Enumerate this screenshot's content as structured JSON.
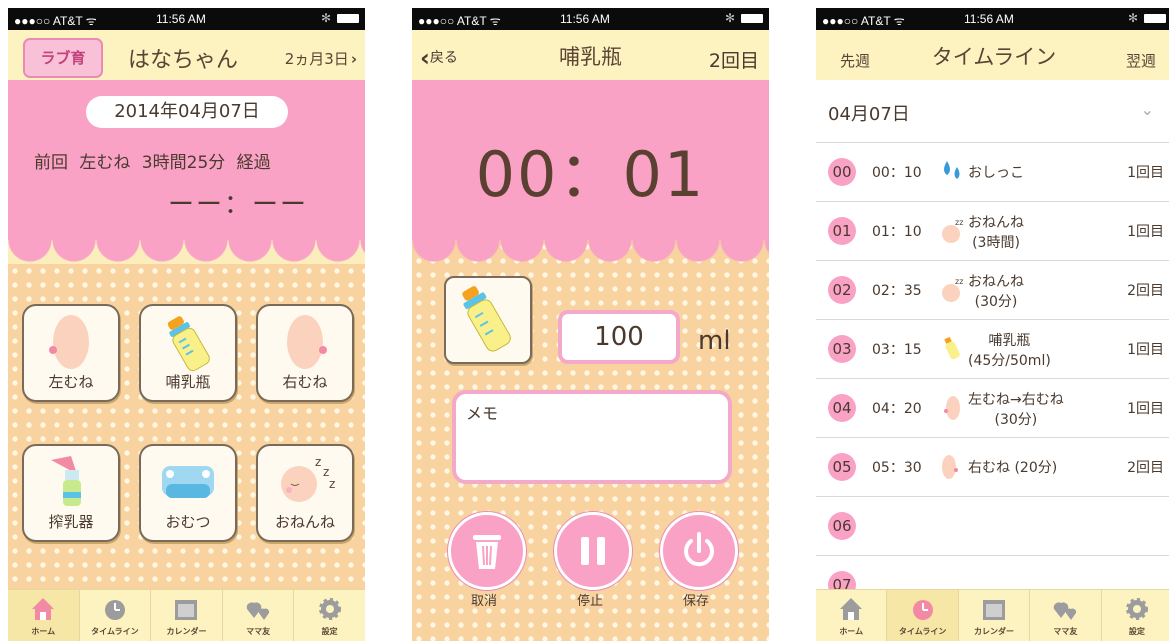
{
  "status_bar": {
    "carrier": "●●●○○ AT&T ᯤ",
    "time": "11:56 AM",
    "bluetooth": "✻"
  },
  "home_screen": {
    "logo": "ラブ育",
    "baby_name": "はなちゃん",
    "age": "2ヵ月3日",
    "age_chevron": "›",
    "date": "2014年04月07日",
    "last_feed": "前回 左むね 3時間25分 経過",
    "blank_time": "ーー：ーー",
    "buttons": [
      {
        "label": "左むね",
        "icon": "left-breast-icon"
      },
      {
        "label": "哺乳瓶",
        "icon": "bottle-icon"
      },
      {
        "label": "右むね",
        "icon": "right-breast-icon"
      },
      {
        "label": "搾乳器",
        "icon": "breast-pump-icon"
      },
      {
        "label": "おむつ",
        "icon": "diaper-icon"
      },
      {
        "label": "おねんね",
        "icon": "sleep-icon"
      }
    ],
    "active_tab": "ホーム"
  },
  "bottle_screen": {
    "back_label": "戻る",
    "title": "哺乳瓶",
    "count": "2回目",
    "timer": "00：01",
    "amount": "100",
    "unit": "ml",
    "memo_placeholder": "メモ",
    "actions": [
      {
        "label": "取消",
        "icon": "trash-icon"
      },
      {
        "label": "停止",
        "icon": "pause-icon"
      },
      {
        "label": "保存",
        "icon": "power-icon"
      }
    ]
  },
  "timeline_screen": {
    "prev_week": "先週",
    "title": "タイムライン",
    "next_week": "翌週",
    "date": "04月07日",
    "rows": [
      {
        "hour": "00",
        "time": "00：10",
        "icon": "water-drop-icon",
        "label": "おしっこ",
        "label2": "",
        "count": "1回目"
      },
      {
        "hour": "01",
        "time": "01：10",
        "icon": "sleeping-baby-icon",
        "label": "おねんね",
        "label2": "(3時間)",
        "count": "1回目"
      },
      {
        "hour": "02",
        "time": "02：35",
        "icon": "sleeping-baby-icon",
        "label": "おねんね",
        "label2": "(30分)",
        "count": "2回目"
      },
      {
        "hour": "03",
        "time": "03：15",
        "icon": "bottle-icon",
        "label": "哺乳瓶",
        "label2": "(45分/50ml)",
        "count": "1回目"
      },
      {
        "hour": "04",
        "time": "04：20",
        "icon": "breast-icon",
        "label": "左むね→右むね",
        "label2": "(30分)",
        "count": "1回目"
      },
      {
        "hour": "05",
        "time": "05：30",
        "icon": "breast-icon",
        "label": "右むね (20分)",
        "label2": "",
        "count": "2回目"
      },
      {
        "hour": "06",
        "time": "",
        "icon": "",
        "label": "",
        "label2": "",
        "count": ""
      },
      {
        "hour": "07",
        "time": "",
        "icon": "",
        "label": "",
        "label2": "",
        "count": ""
      }
    ],
    "active_tab": "タイムライン"
  },
  "tab_bar": [
    {
      "label": "ホーム",
      "icon": "house-icon"
    },
    {
      "label": "タイムライン",
      "icon": "clock-icon"
    },
    {
      "label": "カレンダー",
      "icon": "calendar-icon"
    },
    {
      "label": "ママ友",
      "icon": "hearts-icon"
    },
    {
      "label": "設定",
      "icon": "gear-icon"
    }
  ],
  "colors": {
    "pink": "#f9a2c6",
    "cream": "#fdf3c1",
    "dots": "#f8d29f",
    "text": "#4a3a2e"
  }
}
